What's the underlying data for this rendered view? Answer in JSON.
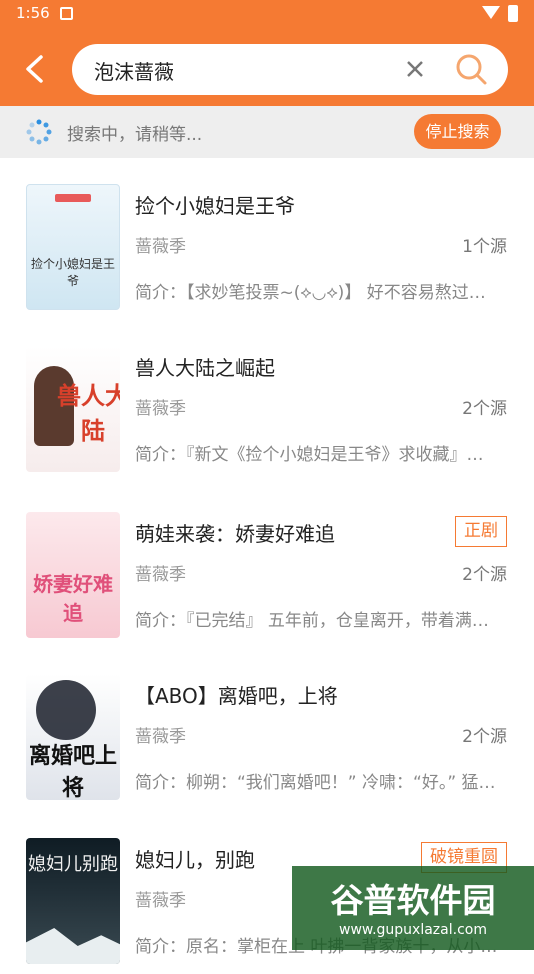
{
  "status": {
    "time": "1:56"
  },
  "search": {
    "query": "泡沫蔷薇"
  },
  "progress": {
    "text": "搜索中，请稍等...",
    "stop_label": "停止搜索"
  },
  "results": [
    {
      "title": "捡个小媳妇是王爷",
      "author": "蔷薇季",
      "sources": "1个源",
      "intro": "简介：【求妙笔投票~(⟡◡⟡)】 好不容易熬过…",
      "tag": "",
      "cover_text": "捡个小媳妇是王爷"
    },
    {
      "title": "兽人大陆之崛起",
      "author": "蔷薇季",
      "sources": "2个源",
      "intro": "简介：『新文《捡个小媳妇是王爷》求收藏』…",
      "tag": "",
      "cover_text": "兽人大陆"
    },
    {
      "title": "萌娃来袭：娇妻好难追",
      "author": "蔷薇季",
      "sources": "2个源",
      "intro": "简介：『已完结』 五年前，仓皇离开，带着满…",
      "tag": "正剧",
      "cover_text": "娇妻好难追"
    },
    {
      "title": "【ABO】离婚吧，上将",
      "author": "蔷薇季",
      "sources": "2个源",
      "intro": "简介：柳朔：“我们离婚吧！” 冷啸：“好。” 猛…",
      "tag": "",
      "cover_text": "离婚吧上将"
    },
    {
      "title": "媳妇儿，别跑",
      "author": "蔷薇季",
      "sources": "",
      "intro": "简介：原名：掌柜在上 叶拂一背家族十，从小…",
      "tag": "破镜重圆",
      "cover_text": "媳妇儿别跑"
    }
  ],
  "watermark": {
    "text": "谷普软件园",
    "url": "www.gupuxlazal.com"
  }
}
